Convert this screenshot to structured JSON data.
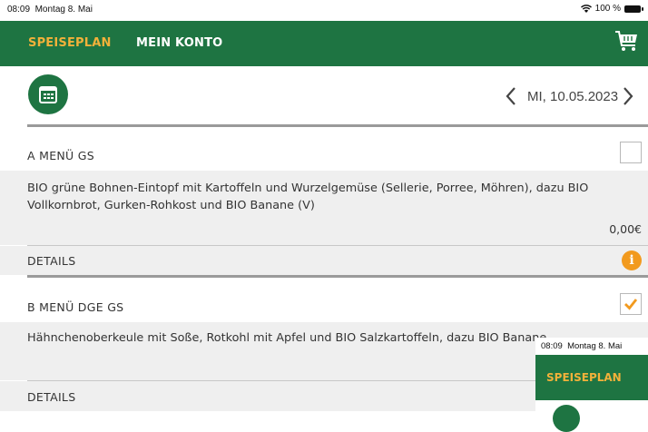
{
  "status_bar": {
    "time": "08:09",
    "date": "Montag 8. Mai",
    "battery": "100 %"
  },
  "nav": {
    "tabs": [
      "SPEISEPLAN",
      "MEIN KONTO"
    ],
    "active_color": "#f2b13a",
    "cart_icon": "shopping-cart-icon"
  },
  "date_selector": {
    "date": "MI, 10.05.2023"
  },
  "menus": [
    {
      "title": "A MENÜ GS",
      "checked": false,
      "description": "BIO grüne Bohnen-Eintopf mit Kartoffeln und Wurzelgemüse (Sellerie, Porree, Möhren), dazu BIO Vollkornbrot, Gurken-Rohkost und BIO Banane (V)",
      "price": "0,00€",
      "details_label": "DETAILS"
    },
    {
      "title": "B MENÜ DGE GS",
      "checked": true,
      "description": "Hähnchenoberkeule mit Soße, Rotkohl mit Apfel und BIO Salzkartoffeln, dazu BIO Banane",
      "details_label": "DETAILS"
    }
  ],
  "overlay": {
    "time": "08:09",
    "date": "Montag 8. Mai",
    "tab": "SPEISEPLAN"
  },
  "colors": {
    "brand_green": "#1e7442",
    "accent_orange": "#f29a1e"
  }
}
